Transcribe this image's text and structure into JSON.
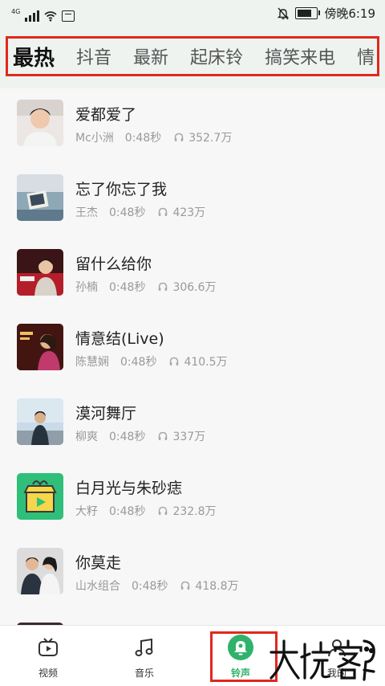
{
  "status_bar": {
    "network": "4G",
    "time": "傍晚6:19",
    "battery_level": 0.85
  },
  "tabs": [
    {
      "label": "最热",
      "active": true
    },
    {
      "label": "抖音",
      "active": false
    },
    {
      "label": "最新",
      "active": false
    },
    {
      "label": "起床铃",
      "active": false
    },
    {
      "label": "搞笑来电",
      "active": false
    },
    {
      "label": "情",
      "active": false
    }
  ],
  "songs": [
    {
      "title": "爱都爱了",
      "singer": "Mc小洲",
      "duration": "0:48秒",
      "plays": "352.7万"
    },
    {
      "title": "忘了你忘了我",
      "singer": "王杰",
      "duration": "0:48秒",
      "plays": "423万"
    },
    {
      "title": "留什么给你",
      "singer": "孙楠",
      "duration": "0:48秒",
      "plays": "306.6万"
    },
    {
      "title": "情意结(Live)",
      "singer": "陈慧娴",
      "duration": "0:48秒",
      "plays": "410.5万"
    },
    {
      "title": "漠河舞厅",
      "singer": "柳爽",
      "duration": "0:48秒",
      "plays": "337万"
    },
    {
      "title": "白月光与朱砂痣",
      "singer": "大籽",
      "duration": "0:48秒",
      "plays": "232.8万"
    },
    {
      "title": "你莫走",
      "singer": "山水组合",
      "duration": "0:48秒",
      "plays": "418.8万"
    }
  ],
  "bottom_nav": [
    {
      "label": "视频",
      "icon": "video-icon",
      "active": false
    },
    {
      "label": "音乐",
      "icon": "music-note-icon",
      "active": false
    },
    {
      "label": "铃声",
      "icon": "ringtone-bell-icon",
      "active": true
    },
    {
      "label": "我的",
      "icon": "profile-icon",
      "active": false
    }
  ],
  "colors": {
    "accent": "#2fb36a",
    "highlight_box": "#e0281e"
  }
}
